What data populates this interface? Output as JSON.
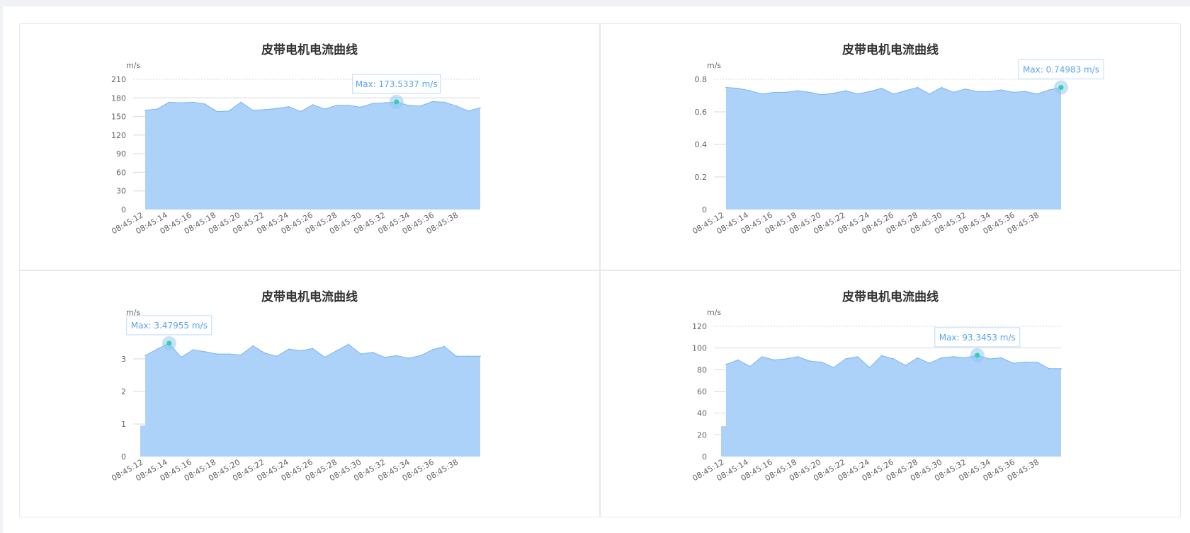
{
  "charts": [
    {
      "title": "皮带电机电流曲线",
      "unit": "m/s",
      "tooltip": "Max: 173.5337 m/s",
      "x_labels": [
        "08:45:12",
        "08:45:14",
        "08:45:16",
        "08:45:18",
        "08:45:20",
        "08:45:22",
        "08:45:24",
        "08:45:26",
        "08:45:28",
        "08:45:30",
        "08:45:32",
        "08:45:34",
        "08:45:36",
        "08:45:38"
      ]
    },
    {
      "title": "皮带电机电流曲线",
      "unit": "m/s",
      "tooltip": "Max: 0.74983 m/s",
      "x_labels": [
        "08:45:12",
        "08:45:14",
        "08:45:16",
        "08:45:18",
        "08:45:20",
        "08:45:22",
        "08:45:24",
        "08:45:26",
        "08:45:28",
        "08:45:30",
        "08:45:32",
        "08:45:34",
        "08:45:36",
        "08:45:38"
      ]
    },
    {
      "title": "皮带电机电流曲线",
      "unit": "m/s",
      "tooltip": "Max: 3.47955 m/s",
      "x_labels": [
        "08:45:12",
        "08:45:14",
        "08:45:16",
        "08:45:18",
        "08:45:20",
        "08:45:22",
        "08:45:24",
        "08:45:26",
        "08:45:28",
        "08:45:30",
        "08:45:32",
        "08:45:34",
        "08:45:36",
        "08:45:38"
      ]
    },
    {
      "title": "皮带电机电流曲线",
      "unit": "m/s",
      "tooltip": "Max: 93.3453 m/s",
      "x_labels": [
        "08:45:12",
        "08:45:14",
        "08:45:16",
        "08:45:18",
        "08:45:20",
        "08:45:22",
        "08:45:24",
        "08:45:26",
        "08:45:28",
        "08:45:30",
        "08:45:32",
        "08:45:34",
        "08:45:36",
        "08:45:38"
      ]
    }
  ],
  "chart_data": [
    {
      "type": "area",
      "title": "皮带电机电流曲线",
      "ylabel": "m/s",
      "ylim": [
        0,
        210
      ],
      "yticks": [
        0,
        30,
        60,
        90,
        120,
        150,
        180,
        210
      ],
      "max_value": 173.5337,
      "max_index": 21,
      "series": [
        {
          "values": [
            160,
            162,
            173,
            172,
            173,
            170,
            158,
            159,
            173,
            160,
            161,
            163,
            166,
            158,
            169,
            162,
            168,
            168,
            165,
            171,
            172,
            173.5337,
            168,
            167,
            174,
            173,
            167,
            159,
            164
          ]
        }
      ]
    },
    {
      "type": "area",
      "title": "皮带电机电流曲线",
      "ylabel": "m/s",
      "ylim": [
        0,
        0.8
      ],
      "yticks": [
        0,
        0.2,
        0.4,
        0.6,
        0.8
      ],
      "max_value": 0.74983,
      "max_index": 28,
      "series": [
        {
          "values": [
            0.75,
            0.745,
            0.73,
            0.71,
            0.72,
            0.72,
            0.73,
            0.72,
            0.705,
            0.715,
            0.73,
            0.71,
            0.725,
            0.745,
            0.71,
            0.73,
            0.75,
            0.71,
            0.75,
            0.72,
            0.74,
            0.725,
            0.725,
            0.735,
            0.72,
            0.725,
            0.71,
            0.735,
            0.74983
          ]
        }
      ]
    },
    {
      "type": "area",
      "title": "皮带电机电流曲线",
      "ylabel": "m/s",
      "ylim": [
        0,
        4
      ],
      "yticks": [
        0,
        1,
        2,
        3
      ],
      "max_value": 3.47955,
      "max_index": 2,
      "series": [
        {
          "values": [
            3.1,
            3.3,
            3.47955,
            3.05,
            3.28,
            3.22,
            3.15,
            3.15,
            3.12,
            3.4,
            3.18,
            3.08,
            3.3,
            3.25,
            3.32,
            3.05,
            3.25,
            3.45,
            3.15,
            3.2,
            3.05,
            3.1,
            3.02,
            3.1,
            3.28,
            3.38,
            3.08,
            3.08,
            3.08
          ]
        }
      ]
    },
    {
      "type": "area",
      "title": "皮带电机电流曲线",
      "ylabel": "m/s",
      "ylim": [
        0,
        120
      ],
      "yticks": [
        0,
        20,
        40,
        60,
        80,
        100,
        120
      ],
      "max_value": 93.3453,
      "max_index": 21,
      "series": [
        {
          "values": [
            85,
            89,
            83,
            92,
            89,
            90,
            92,
            88,
            87,
            82,
            90,
            92,
            82,
            93,
            90,
            84,
            91,
            86,
            91,
            92,
            91,
            93.3453,
            90,
            91,
            86,
            87,
            87,
            81,
            81
          ]
        }
      ]
    }
  ],
  "colors": {
    "area_fill": "#acd2f9",
    "line": "#7ab5ee",
    "grid": "#d8d8d8",
    "marker": "#2fd3a5",
    "tooltip_text": "#5aa5ef",
    "tooltip_border": "#bcdcf8"
  }
}
